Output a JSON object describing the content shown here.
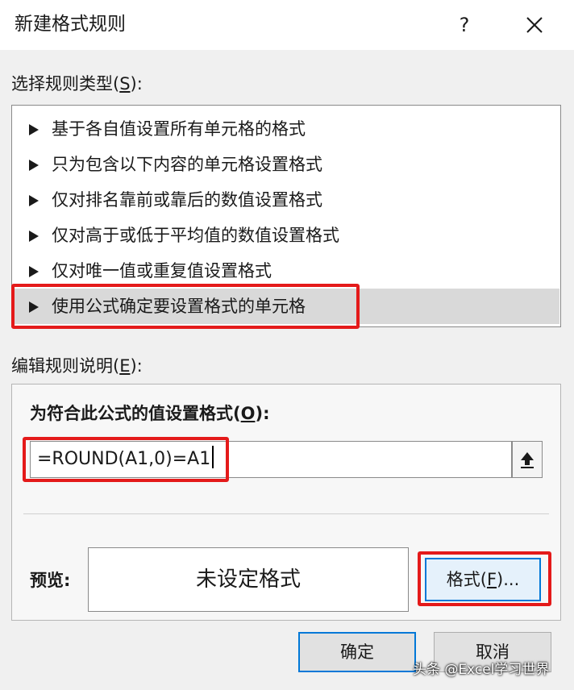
{
  "window": {
    "title": "新建格式规则",
    "help_label": "?",
    "close_icon": "close-icon"
  },
  "rule_type": {
    "label": "选择规则类型(",
    "accel": "S",
    "label_end": "):",
    "items": [
      {
        "label": "基于各自值设置所有单元格的格式",
        "selected": false
      },
      {
        "label": "只为包含以下内容的单元格设置格式",
        "selected": false
      },
      {
        "label": "仅对排名靠前或靠后的数值设置格式",
        "selected": false
      },
      {
        "label": "仅对高于或低于平均值的数值设置格式",
        "selected": false
      },
      {
        "label": "仅对唯一值或重复值设置格式",
        "selected": false
      },
      {
        "label": "使用公式确定要设置格式的单元格",
        "selected": true
      }
    ]
  },
  "rule_desc": {
    "label": "编辑规则说明(",
    "accel": "E",
    "label_end": "):",
    "formula_label": "为符合此公式的值设置格式(",
    "formula_accel": "O",
    "formula_label_end": "):",
    "formula_value": "=ROUND(A1,0)=A1",
    "collapse_icon": "collapse-dialog-icon",
    "preview_label": "预览:",
    "preview_text": "未设定格式",
    "format_button": "格式(",
    "format_accel": "F",
    "format_button_end": ")..."
  },
  "footer": {
    "ok_label": "确定",
    "cancel_label": "取消"
  },
  "watermark": "头条 @Excel学习世界",
  "colors": {
    "highlight": "#e41a1a",
    "accent": "#0078d7",
    "selected_row": "#d9d9d9"
  }
}
